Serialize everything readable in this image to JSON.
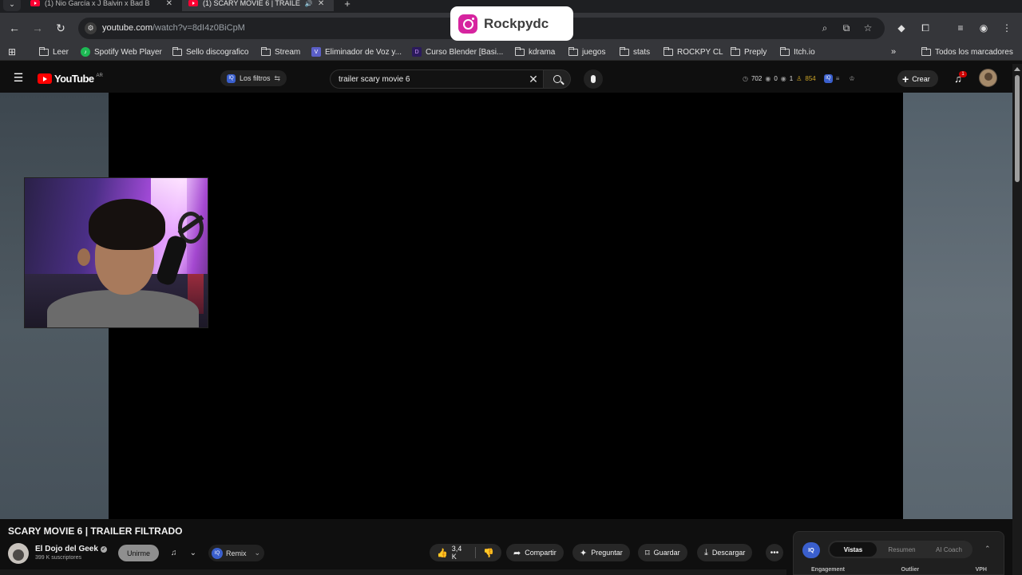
{
  "browser": {
    "tabs": [
      {
        "label": "(1) Nio García x J Balvin x Bad B",
        "active": false
      },
      {
        "label": "(1) SCARY MOVIE 6 | TRAILE",
        "active": true
      }
    ],
    "url": {
      "domain": "youtube.com",
      "path": "/watch?v=8dI4z0BiCpM"
    },
    "bookmarks": [
      {
        "label": "Leer",
        "icon": "folder-icon"
      },
      {
        "label": "Spotify Web Player",
        "icon": "spotify-icon"
      },
      {
        "label": "Sello discografico",
        "icon": "folder-icon"
      },
      {
        "label": "Stream",
        "icon": "folder-icon"
      },
      {
        "label": "Eliminador de Voz y...",
        "icon": "v-icon"
      },
      {
        "label": "Curso Blender [Basi...",
        "icon": "blender-icon"
      },
      {
        "label": "kdrama",
        "icon": "folder-icon"
      },
      {
        "label": "juegos",
        "icon": "folder-icon"
      },
      {
        "label": "stats",
        "icon": "folder-icon"
      },
      {
        "label": "ROCKPY CL",
        "icon": "folder-icon"
      },
      {
        "label": "Preply",
        "icon": "folder-icon"
      },
      {
        "label": "Itch.io",
        "icon": "folder-icon"
      }
    ],
    "all_bookmarks": "Todos los marcadores"
  },
  "overlay": {
    "instagram_handle": "Rockpydc"
  },
  "youtube": {
    "logo_text": "YouTube",
    "region": "AR",
    "filters_label": "Los filtros",
    "search_value": "trailer scary movie 6",
    "stats": {
      "clock": "702",
      "eye1": "0",
      "eye2": "1",
      "users": "854"
    },
    "create_label": "Crear",
    "notification_count": "1"
  },
  "video": {
    "title": "SCARY MOVIE 6 | TRAILER FILTRADO",
    "channel": "El Dojo del Geek",
    "subscribers": "399 K suscriptores",
    "join_label": "Unirme",
    "remix_label": "Remix",
    "likes": "3,4 K",
    "share_label": "Compartir",
    "ask_label": "Preguntar",
    "save_label": "Guardar",
    "download_label": "Descargar"
  },
  "iq_panel": {
    "logo": "IQ",
    "tabs": [
      "Vistas",
      "Resumen",
      "AI Coach"
    ],
    "active_tab": "Vistas",
    "columns": [
      "Engagement",
      "Outlier",
      "VPH"
    ]
  },
  "colors": {
    "accent_red": "#ff0000",
    "iq_blue": "#3a5fcd",
    "instagram": "#d6249f"
  }
}
